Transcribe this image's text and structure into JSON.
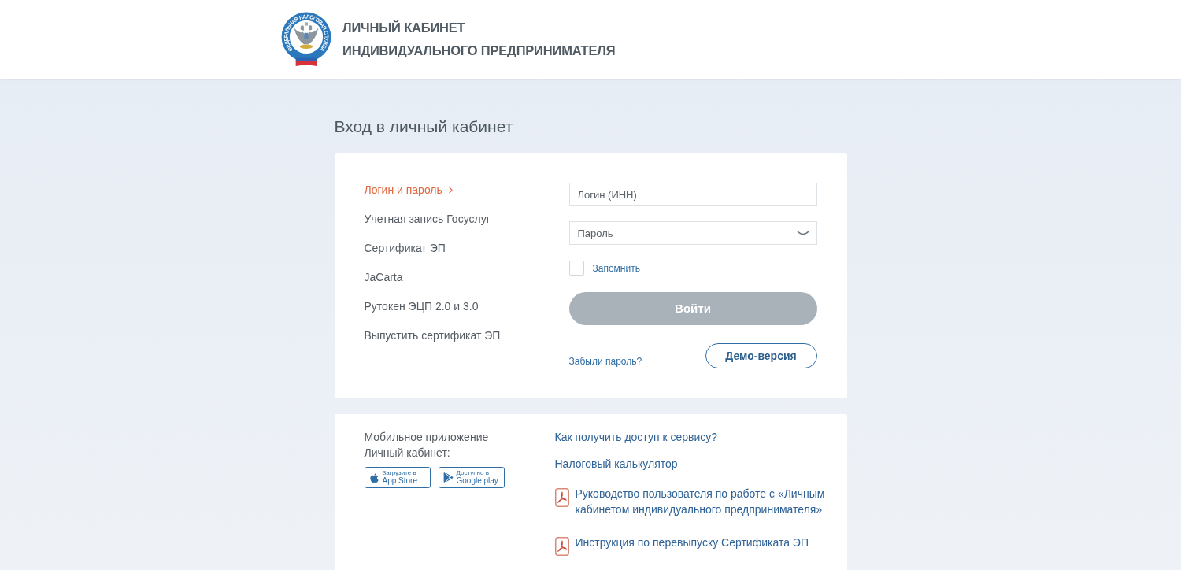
{
  "header": {
    "emblem_text": "ФЕДЕРАЛЬНАЯ НАЛОГОВАЯ СЛУЖБА",
    "title_lines": [
      "ЛИЧНЫЙ КАБИНЕТ",
      "ИНДИВИДУАЛЬНОГО ПРЕДПРИНИМАТЕЛЯ"
    ]
  },
  "page_title": "Вход в личный кабинет",
  "login_methods": [
    {
      "label": "Логин и пароль",
      "selected": true
    },
    {
      "label": "Учетная запись Госуслуг",
      "selected": false
    },
    {
      "label": "Сертификат ЭП",
      "selected": false
    },
    {
      "label": "JaCarta",
      "selected": false
    },
    {
      "label": "Рутокен ЭЦП 2.0 и 3.0",
      "selected": false
    },
    {
      "label": "Выпустить сертификат ЭП",
      "selected": false
    }
  ],
  "login_form": {
    "login_field": {
      "placeholder": "Логин (ИНН)"
    },
    "password_field": {
      "placeholder": "Пароль"
    },
    "remember": {
      "label": "Запомнить",
      "checked": false
    },
    "submit_button": {
      "label": "Войти",
      "disabled": true
    },
    "forgot_link": "Забыли пароль?",
    "demo_button": "Демо-версия"
  },
  "mobile_app": {
    "text": "Мобильное приложение Личный кабинет:",
    "stores": [
      {
        "kind": "apple",
        "caption": "Загрузите в",
        "name": "App Store"
      },
      {
        "kind": "google",
        "caption": "Доступно в",
        "name": "Google play"
      }
    ]
  },
  "help_links": [
    {
      "kind": "link",
      "label": "Как получить доступ к сервису?"
    },
    {
      "kind": "link",
      "label": "Налоговый калькулятор"
    },
    {
      "kind": "pdf",
      "label": "Руководство пользователя по работе с «Личным кабинетом индивидуального предпринимателя»"
    },
    {
      "kind": "pdf",
      "label": "Инструкция по перевыпуску Сертификата ЭП"
    }
  ]
}
